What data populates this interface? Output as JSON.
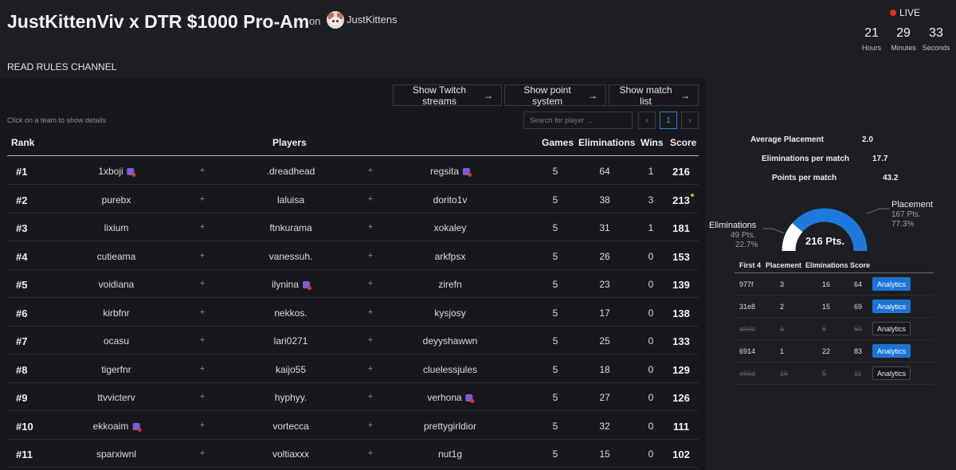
{
  "header": {
    "title": "JustKittenViv x DTR $1000 Pro-Am",
    "on_label": "on",
    "organizer": "JustKittens",
    "live_label": "LIVE",
    "countdown": [
      {
        "value": "21",
        "unit": "Hours"
      },
      {
        "value": "29",
        "unit": "Minutes"
      },
      {
        "value": "33",
        "unit": "Seconds"
      }
    ]
  },
  "rules_text": "READ RULES CHANNEL",
  "buttons": {
    "twitch": "Show Twitch streams",
    "points": "Show point system",
    "matches": "Show match list"
  },
  "hint": "Click on a team to show details",
  "search": {
    "placeholder": "Search for player ...",
    "value": ""
  },
  "pagination": {
    "prev": "‹",
    "current": "1",
    "next": "›"
  },
  "table": {
    "headers": {
      "rank": "Rank",
      "players": "Players",
      "games": "Games",
      "eliminations": "Eliminations",
      "wins": "Wins",
      "score": "Score"
    },
    "plus": "+",
    "rows": [
      {
        "rank": "#1",
        "p1": "1xboji",
        "p2": ".dreadhead",
        "p3": "regsita",
        "games": "5",
        "elims": "64",
        "wins": "1",
        "score": "216"
      },
      {
        "rank": "#2",
        "p1": "purebx",
        "p2": "laluisa",
        "p3": "dorito1v",
        "games": "5",
        "elims": "38",
        "wins": "3",
        "score": "213"
      },
      {
        "rank": "#3",
        "p1": "lixium",
        "p2": "ftnkurama",
        "p3": "xokaley",
        "games": "5",
        "elims": "31",
        "wins": "1",
        "score": "181"
      },
      {
        "rank": "#4",
        "p1": "cutieama",
        "p2": "vanessuh.",
        "p3": "arkfpsx",
        "games": "5",
        "elims": "26",
        "wins": "0",
        "score": "153"
      },
      {
        "rank": "#5",
        "p1": "voidiana",
        "p2": "ilynina",
        "p3": "zirefn",
        "games": "5",
        "elims": "23",
        "wins": "0",
        "score": "139"
      },
      {
        "rank": "#6",
        "p1": "kirbfnr",
        "p2": "nekkos.",
        "p3": "kysjosy",
        "games": "5",
        "elims": "17",
        "wins": "0",
        "score": "138"
      },
      {
        "rank": "#7",
        "p1": "ocasu",
        "p2": "lari0271",
        "p3": "deyyshawwn",
        "games": "5",
        "elims": "25",
        "wins": "0",
        "score": "133"
      },
      {
        "rank": "#8",
        "p1": "tigerfnr",
        "p2": "kaijo55",
        "p3": "cluelessjules",
        "games": "5",
        "elims": "18",
        "wins": "0",
        "score": "129"
      },
      {
        "rank": "#9",
        "p1": "ttvvicterv",
        "p2": "hyphyy.",
        "p3": "verhona",
        "games": "5",
        "elims": "27",
        "wins": "0",
        "score": "126"
      },
      {
        "rank": "#10",
        "p1": "ekkoaim",
        "p2": "vortecca",
        "p3": "prettygirldior",
        "games": "5",
        "elims": "32",
        "wins": "0",
        "score": "111"
      },
      {
        "rank": "#11",
        "p1": "sparxiwnl",
        "p2": "voltiaxxx",
        "p3": "nut1g",
        "games": "5",
        "elims": "15",
        "wins": "0",
        "score": "102"
      }
    ]
  },
  "details": {
    "avg_placement_label": "Average Placement",
    "avg_placement": "2.0",
    "elims_per_match_label": "Eliminations per match",
    "elims_per_match": "17.7",
    "points_per_match_label": "Points per match",
    "points_per_match": "43.2",
    "gauge": {
      "total": "216 Pts.",
      "elim_label": "Eliminations",
      "elim_pts": "49 Pts.",
      "elim_pct": "22.7%",
      "place_label": "Placement",
      "place_pts": "167 Pts.",
      "place_pct": "77.3%",
      "elim_fraction": 0.227,
      "colors": {
        "placement": "#1f78dc",
        "eliminations": "#ffffff"
      }
    },
    "matches_headers": {
      "first4": "First 4",
      "placement": "Placement",
      "eliminations": "Eliminations",
      "score": "Score"
    },
    "analytics_label": "Analytics",
    "matches": [
      {
        "id": "977f",
        "placement": "3",
        "elims": "16",
        "score": "64",
        "counted": true
      },
      {
        "id": "31e8",
        "placement": "2",
        "elims": "15",
        "score": "69",
        "counted": true
      },
      {
        "id": "a9de",
        "placement": "6",
        "elims": "6",
        "score": "50",
        "counted": false
      },
      {
        "id": "6914",
        "placement": "1",
        "elims": "22",
        "score": "83",
        "counted": true
      },
      {
        "id": "e56d",
        "placement": "16",
        "elims": "5",
        "score": "11",
        "counted": false
      }
    ]
  }
}
